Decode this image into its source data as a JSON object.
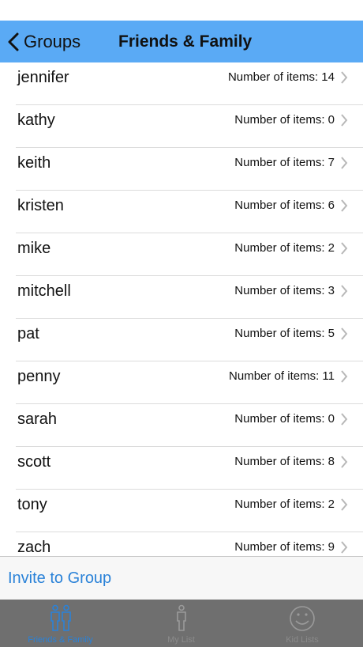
{
  "nav": {
    "back_label": "Groups",
    "title": "Friends & Family"
  },
  "contacts": [
    {
      "name": "jennifer",
      "count": "Number of items: 14"
    },
    {
      "name": "kathy",
      "count": "Number of items: 0"
    },
    {
      "name": "keith",
      "count": "Number of items: 7"
    },
    {
      "name": "kristen",
      "count": "Number of items: 6"
    },
    {
      "name": "mike",
      "count": "Number of items: 2"
    },
    {
      "name": "mitchell",
      "count": "Number of items: 3"
    },
    {
      "name": "pat",
      "count": "Number of items: 5"
    },
    {
      "name": "penny",
      "count": "Number of items: 11"
    },
    {
      "name": "sarah",
      "count": "Number of items: 0"
    },
    {
      "name": "scott",
      "count": "Number of items: 8"
    },
    {
      "name": "tony",
      "count": "Number of items: 2"
    },
    {
      "name": "zach",
      "count": "Number of items: 9"
    }
  ],
  "invite": {
    "label": "Invite to Group"
  },
  "tabs": [
    {
      "label": "Friends & Family",
      "icon": "two-people-icon",
      "active": true
    },
    {
      "label": "My List",
      "icon": "person-icon",
      "active": false
    },
    {
      "label": "Kid Lists",
      "icon": "smiley-icon",
      "active": false
    }
  ],
  "colors": {
    "nav_bar": "#5aaaf5",
    "link": "#2a82d8",
    "tab_bar": "#6f6f6f"
  }
}
